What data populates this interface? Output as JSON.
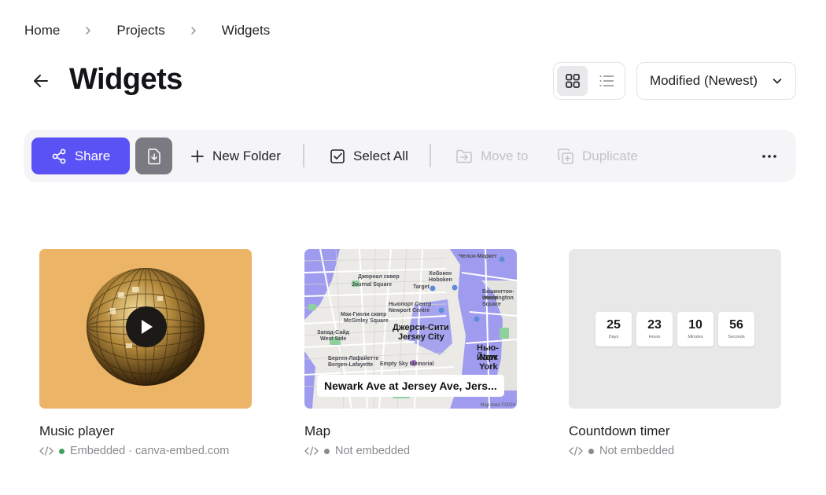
{
  "breadcrumb": [
    "Home",
    "Projects",
    "Widgets"
  ],
  "page": {
    "title": "Widgets"
  },
  "sort": {
    "selected": "Modified (Newest)"
  },
  "toolbar": {
    "share": "Share",
    "new_folder": "New Folder",
    "select_all": "Select All",
    "move_to": "Move to",
    "duplicate": "Duplicate"
  },
  "colors": {
    "accent": "#5b52f5",
    "embedded": "#3fa160",
    "not_embedded": "#8a8a90"
  },
  "cards": [
    {
      "title": "Music player",
      "status": "Embedded · canva-embed.com"
    },
    {
      "title": "Map",
      "status": "Not embedded",
      "map": {
        "label": "Newark Ave at Jersey Ave, Jers...",
        "places": [
          "Джорнал сквер",
          "Journal Square",
          "Target",
          "Хобокен",
          "Hoboken",
          "Ньюпорт Сентр",
          "Newport Centre",
          "Вашингтон-сквер",
          "Washington Square",
          "Мак-Гинли сквер",
          "McGinley Square",
          "Запад-Сайд",
          "West Side",
          "Берген-Лафайетте",
          "Bergen-Lafayette",
          "Empty Sky Memorial",
          "Челси-Маркет"
        ],
        "cities": [
          "Джерси-Сити",
          "Jersey City",
          "Нью-Йорк",
          "New York"
        ],
        "credit": "Map data ©2024"
      }
    },
    {
      "title": "Countdown timer",
      "status": "Not embedded",
      "countdown": [
        {
          "value": "25",
          "unit": "Days"
        },
        {
          "value": "23",
          "unit": "Hours"
        },
        {
          "value": "10",
          "unit": "Minutes"
        },
        {
          "value": "56",
          "unit": "Seconds"
        }
      ]
    }
  ]
}
